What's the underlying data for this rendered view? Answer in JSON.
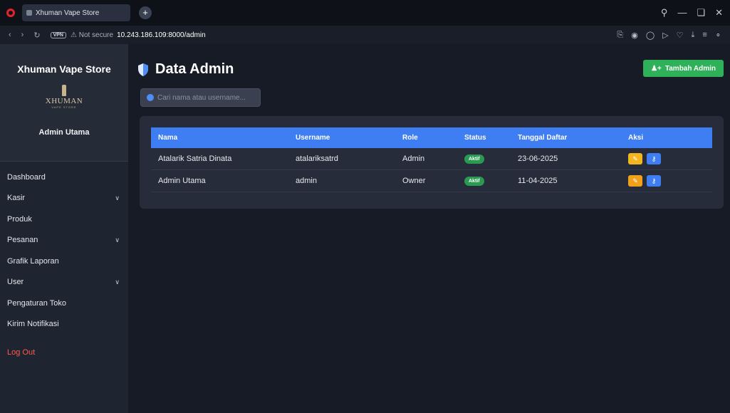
{
  "browser": {
    "tab_title": "Xhuman Vape Store",
    "new_tab_icon": "plus-icon",
    "vpn_label": "VPN",
    "security_label": "Not secure",
    "url": "10.243.186.109:8000/admin"
  },
  "sidebar": {
    "store_name": "Xhuman Vape Store",
    "logo_text": "XHUMAN",
    "logo_subtext": "VAPE STORE",
    "user_role": "Admin Utama",
    "items": [
      {
        "label": "Dashboard",
        "has_submenu": false
      },
      {
        "label": "Kasir",
        "has_submenu": true
      },
      {
        "label": "Produk",
        "has_submenu": false
      },
      {
        "label": "Pesanan",
        "has_submenu": true
      },
      {
        "label": "Grafik Laporan",
        "has_submenu": false
      },
      {
        "label": "User",
        "has_submenu": true
      },
      {
        "label": "Pengaturan Toko",
        "has_submenu": false
      },
      {
        "label": "Kirim Notifikasi",
        "has_submenu": false
      },
      {
        "label": "Log Out",
        "has_submenu": false
      }
    ]
  },
  "main": {
    "title": "Data Admin",
    "add_button_label": "Tambah Admin",
    "search_placeholder": "Cari nama atau username...",
    "table": {
      "headers": [
        "Nama",
        "Username",
        "Role",
        "Status",
        "Tanggal Daftar",
        "Aksi"
      ],
      "rows": [
        {
          "nama": "Atalarik Satria Dinata",
          "username": "atalariksatrd",
          "role": "Admin",
          "status": "Aktif",
          "tanggal": "23-06-2025"
        },
        {
          "nama": "Admin Utama",
          "username": "admin",
          "role": "Owner",
          "status": "Aktif",
          "tanggal": "11-04-2025"
        }
      ]
    }
  },
  "colors": {
    "accent_blue": "#3f7ef2",
    "success_green": "#2fb15a",
    "edit_yellow": "#f3b61f",
    "logout_red": "#ff5a4f",
    "sidebar_bg": "#1f2431",
    "card_bg": "#272c3a"
  }
}
